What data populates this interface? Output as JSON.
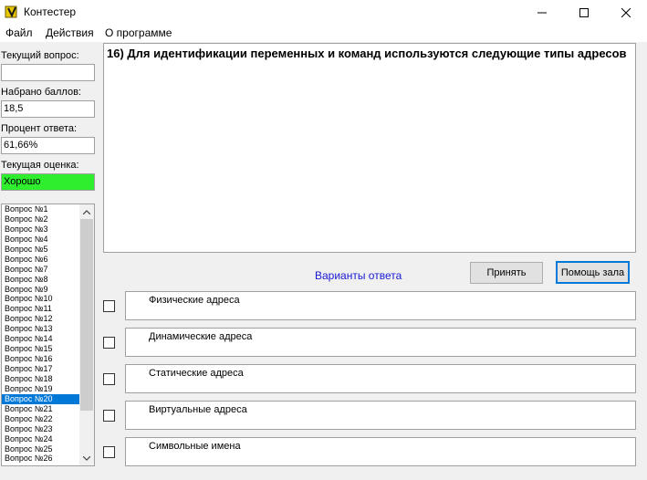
{
  "window": {
    "title": "Контестер"
  },
  "menu": [
    "Файл",
    "Действия",
    "О программе"
  ],
  "left": {
    "current_question_label": "Текущий вопрос:",
    "current_question_value": "",
    "score_label": "Набрано баллов:",
    "score_value": "18,5",
    "percent_label": "Процент ответа:",
    "percent_value": "61,66%",
    "grade_label": "Текущая оценка:",
    "grade_value": "Хорошо",
    "grade_color": "#2eee2e"
  },
  "question_list": {
    "items": [
      "Вопрос №1",
      "Вопрос №2",
      "Вопрос №3",
      "Вопрос №4",
      "Вопрос №5",
      "Вопрос №6",
      "Вопрос №7",
      "Вопрос №8",
      "Вопрос №9",
      "Вопрос №10",
      "Вопрос №11",
      "Вопрос №12",
      "Вопрос №13",
      "Вопрос №14",
      "Вопрос №15",
      "Вопрос №16",
      "Вопрос №17",
      "Вопрос №18",
      "Вопрос №19",
      "Вопрос №20",
      "Вопрос №21",
      "Вопрос №22",
      "Вопрос №23",
      "Вопрос №24",
      "Вопрос №25",
      "Вопрос №26"
    ],
    "selected_index": 19
  },
  "question": {
    "text": "16) Для идентификации переменных и команд используются следующие типы адресов"
  },
  "variants_label": "Варианты ответа",
  "buttons": {
    "accept": "Принять",
    "help": "Помощь зала"
  },
  "answers": [
    "Физические адреса",
    "Динамические адреса",
    "Статические адреса",
    "Виртуальные адреса",
    "Символьные имена"
  ],
  "accent_color": "#0078d7"
}
